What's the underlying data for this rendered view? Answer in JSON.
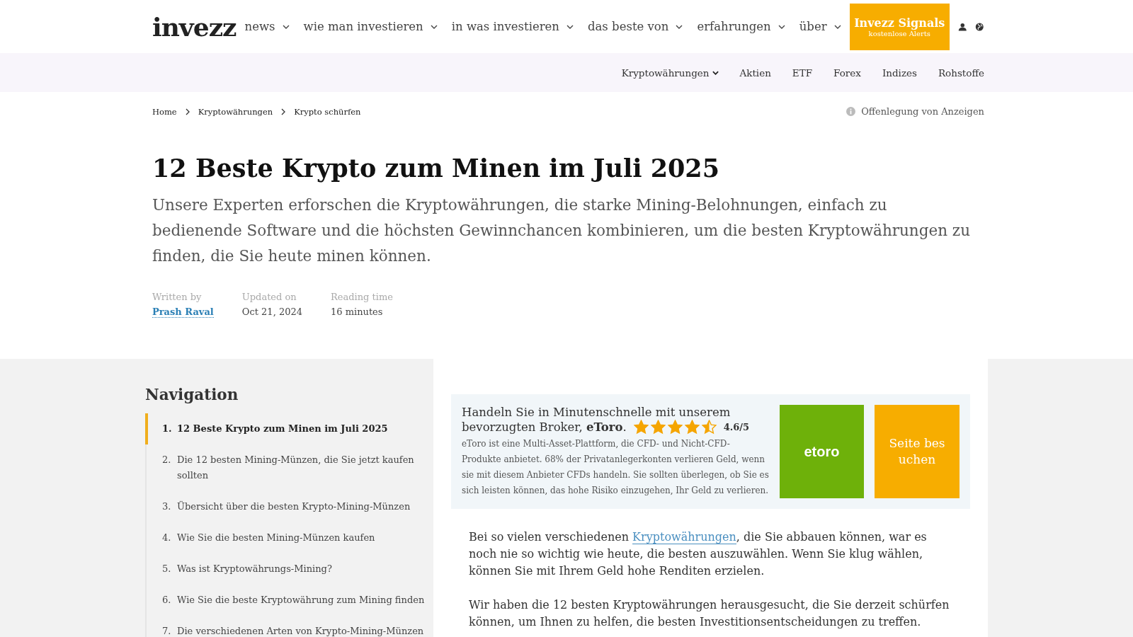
{
  "header": {
    "logo": "invezz",
    "nav": [
      {
        "label": "news"
      },
      {
        "label": "wie man investieren"
      },
      {
        "label": "in was investieren"
      },
      {
        "label": "das beste von"
      },
      {
        "label": "erfahrungen"
      },
      {
        "label": "über"
      }
    ],
    "signals": {
      "title": "Invezz Signals",
      "subtitle": "kostenlose Alerts"
    }
  },
  "subnav": [
    {
      "label": "Kryptowährungen",
      "dropdown": true
    },
    {
      "label": "Aktien",
      "dropdown": false
    },
    {
      "label": "ETF",
      "dropdown": false
    },
    {
      "label": "Forex",
      "dropdown": false
    },
    {
      "label": "Indizes",
      "dropdown": false
    },
    {
      "label": "Rohstoffe",
      "dropdown": false
    }
  ],
  "breadcrumbs": [
    "Home",
    "Kryptowährungen",
    "Krypto schürfen"
  ],
  "disclosure": "Offenlegung von Anzeigen",
  "title": "12 Beste Krypto zum Minen im Juli 2025",
  "intro": "Unsere Experten erforschen die Kryptowährungen, die starke Mining-Belohnungen, einfach zu bedienende Software und die höchsten Gewinnchancen kombinieren, um die besten Kryptowährungen zu finden, die Sie heute minen können.",
  "meta": [
    {
      "label": "Written by",
      "value": "Prash Raval",
      "kind": "link"
    },
    {
      "label": "Updated on",
      "value": "Oct 21, 2024",
      "kind": "text"
    },
    {
      "label": "Reading time",
      "value": "16 minutes",
      "kind": "text"
    }
  ],
  "navigation": {
    "title": "Navigation",
    "items": [
      {
        "number": "1.",
        "label": "12 Beste Krypto zum Minen im Juli 2025",
        "selected": true
      },
      {
        "number": "2.",
        "label": "Die 12 besten Mining-Münzen, die Sie jetzt kaufen sollten",
        "selected": false
      },
      {
        "number": "3.",
        "label": "Übersicht über die besten Krypto-Mining-Münzen",
        "selected": false
      },
      {
        "number": "4.",
        "label": "Wie Sie die besten Mining-Münzen kaufen",
        "selected": false
      },
      {
        "number": "5.",
        "label": "Was ist Kryptowährungs-Mining?",
        "selected": false
      },
      {
        "number": "6.",
        "label": "Wie Sie die beste Kryptowährung zum Mining finden",
        "selected": false
      },
      {
        "number": "7.",
        "label": "Die verschiedenen Arten von Krypto-Mining-Münzen",
        "selected": false
      }
    ]
  },
  "broker_card": {
    "headline": "Handeln Sie in Minutenschnelle mit unserem",
    "headline_continued": "bevorzugten Broker, **eToro**.",
    "stars": 4.5,
    "rating": "4.6/5",
    "disclaimer": "eToro ist eine Multi-Asset-Plattform, die CFD- und Nicht-CFD-Produkte anbietet. 68% der Privatanlegerkonten verlieren Geld, wenn sie mit diesem Anbieter CFDs handeln. Sie sollten überlegen, ob Sie es sich leisten können, das hohe Risiko einzugehen, Ihr Geld zu verlieren.",
    "logo": "etoro",
    "button": "Seite besuchen"
  },
  "body": [
    {
      "before": "Bei so vielen verschiedenen ",
      "link": "Kryptowährungen",
      "after": ", die Sie abbauen können, war es noch nie so wichtig wie heute, die besten auszuwählen. Wenn Sie klug wählen, können Sie mit Ihrem Geld hohe Renditen erzielen."
    },
    {
      "before": "Wir haben die 12 besten Kryptowährungen herausgesucht, die Sie derzeit schürfen können, um Ihnen zu helfen, die besten Investitionsentscheidungen zu treffen."
    }
  ]
}
